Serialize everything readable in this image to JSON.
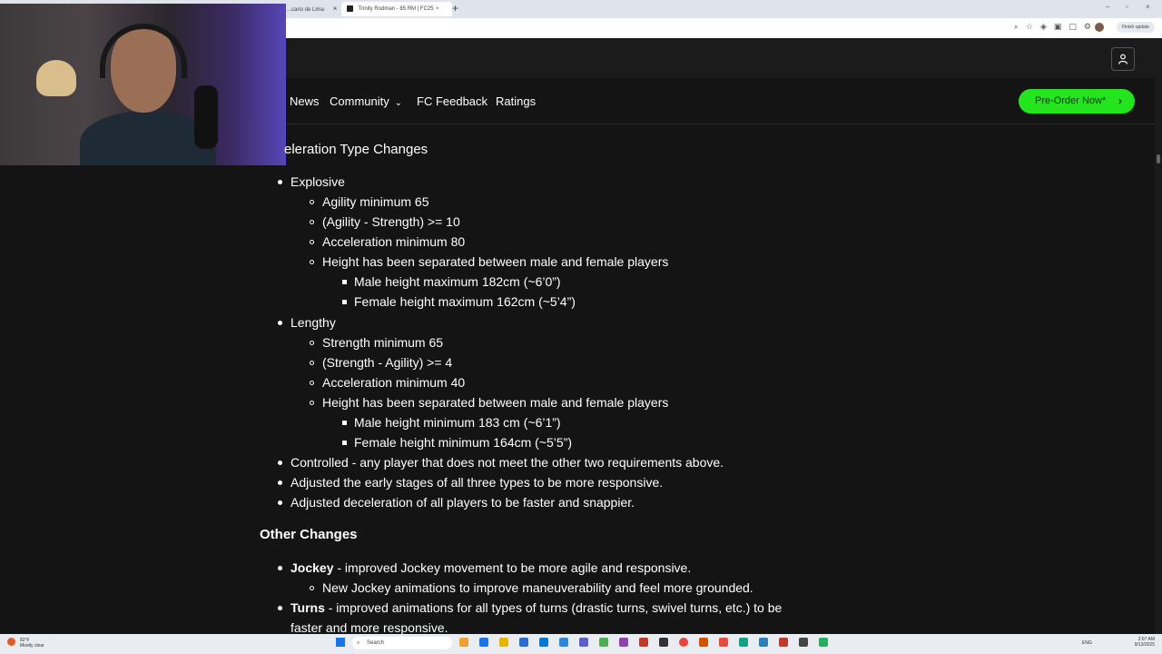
{
  "browser": {
    "tabs": [
      {
        "title": "...cario de Lima",
        "active": false
      },
      {
        "title": "Trinity Rodman - 85 RM | FC25",
        "active": true
      }
    ],
    "finish_update": "Finish update"
  },
  "site": {
    "nav": {
      "items": [
        "News",
        "Community",
        "FC Feedback",
        "Ratings"
      ],
      "cta": "Pre-Order Now*"
    }
  },
  "content": {
    "section_heading": "eleration Type Changes",
    "acceleration": [
      {
        "label": "Explosive",
        "criteria": [
          "Agility minimum 65",
          "(Agility - Strength) >= 10",
          "Acceleration minimum 80",
          "Height has been separated between male and female players"
        ],
        "height": [
          "Male height maximum 182cm (~6’0”)",
          "Female height maximum 162cm (~5’4”)"
        ]
      },
      {
        "label": "Lengthy",
        "criteria": [
          "Strength minimum 65",
          "(Strength - Agility) >= 4",
          "Acceleration minimum 40",
          "Height has been separated between male and female players"
        ],
        "height": [
          "Male height minimum 183 cm (~6’1”)",
          "Female height minimum 164cm (~5’5”)"
        ]
      }
    ],
    "other_bullets": [
      "Controlled - any player that does not meet the other two requirements above.",
      "Adjusted the early stages of all three types to be more responsive.",
      "Adjusted deceleration of all players to be faster and snappier."
    ],
    "other_heading": "Other Changes",
    "jockey": {
      "term": "Jockey",
      "text": " - improved Jockey movement to be more agile and responsive.",
      "sub": "New Jockey animations to improve maneuverability and feel more grounded."
    },
    "turns": {
      "term": "Turns",
      "text": " - improved animations for all types of turns (drastic turns, swivel turns, etc.) to be",
      "text2": "faster and more responsive."
    }
  },
  "taskbar": {
    "weather_temp": "82°F",
    "weather_desc": "Mostly clear",
    "search": "Search",
    "lang": "ENG",
    "time": "2:07 AM",
    "date": "9/13/2025"
  },
  "colors": {
    "page_bg": "#141414",
    "cta_green": "#24e51d",
    "text": "#ffffff"
  },
  "icons": [
    "user-icon",
    "chevron-down-icon",
    "arrow-right-icon",
    "windows-icon",
    "search-icon"
  ]
}
